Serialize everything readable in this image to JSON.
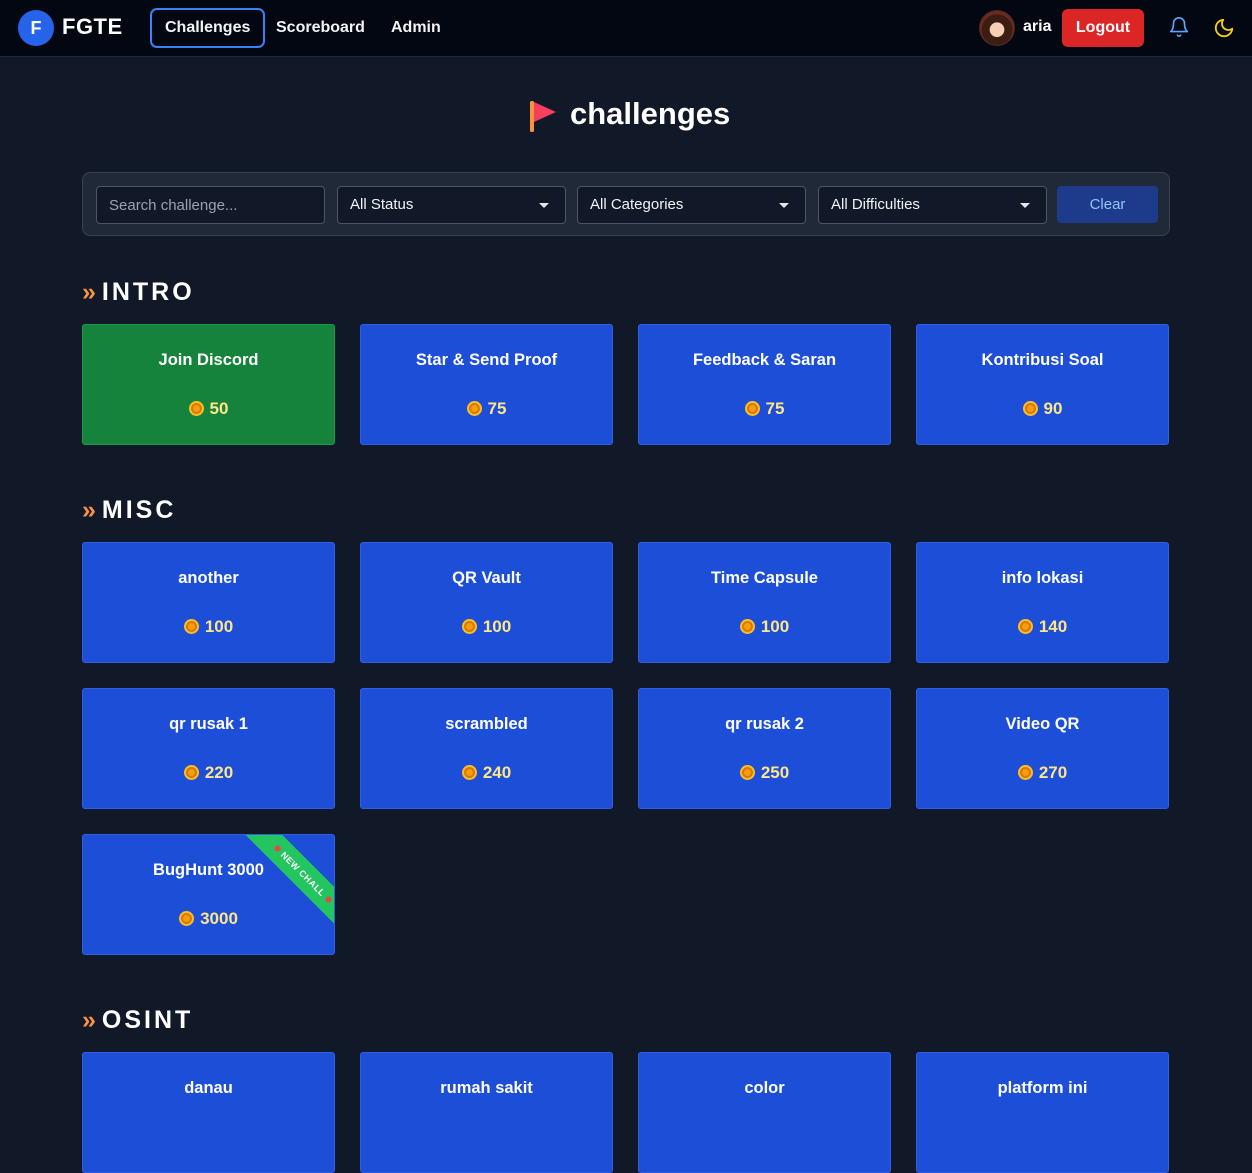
{
  "header": {
    "brand_initial": "F",
    "brand_name": "FGTE",
    "nav": [
      {
        "label": "Challenges",
        "active": true
      },
      {
        "label": "Scoreboard",
        "active": false
      },
      {
        "label": "Admin",
        "active": false
      }
    ],
    "username": "aria",
    "logout_label": "Logout"
  },
  "page": {
    "title": "challenges"
  },
  "filters": {
    "search_placeholder": "Search challenge...",
    "status": "All Status",
    "category": "All Categories",
    "difficulty": "All Difficulties",
    "clear_label": "Clear"
  },
  "sections": [
    {
      "name": "INTRO",
      "challenges": [
        {
          "title": "Join Discord",
          "points": "50",
          "solved": true
        },
        {
          "title": "Star & Send Proof",
          "points": "75",
          "solved": false
        },
        {
          "title": "Feedback & Saran",
          "points": "75",
          "solved": false
        },
        {
          "title": "Kontribusi Soal",
          "points": "90",
          "solved": false
        }
      ]
    },
    {
      "name": "MISC",
      "challenges": [
        {
          "title": "another",
          "points": "100",
          "solved": false
        },
        {
          "title": "QR Vault",
          "points": "100",
          "solved": false
        },
        {
          "title": "Time Capsule",
          "points": "100",
          "solved": false
        },
        {
          "title": "info lokasi",
          "points": "140",
          "solved": false
        },
        {
          "title": "qr rusak 1",
          "points": "220",
          "solved": false
        },
        {
          "title": "scrambled",
          "points": "240",
          "solved": false
        },
        {
          "title": "qr rusak 2",
          "points": "250",
          "solved": false
        },
        {
          "title": "Video QR",
          "points": "270",
          "solved": false
        },
        {
          "title": "BugHunt 3000",
          "points": "3000",
          "solved": false,
          "ribbon": "NEW CHALL"
        }
      ]
    },
    {
      "name": "OSINT",
      "challenges": [
        {
          "title": "danau",
          "points": "",
          "solved": false
        },
        {
          "title": "rumah sakit",
          "points": "",
          "solved": false
        },
        {
          "title": "color",
          "points": "",
          "solved": false
        },
        {
          "title": "platform ini",
          "points": "",
          "solved": false
        }
      ]
    }
  ],
  "colors": {
    "background": "#111827",
    "card_unsolved": "#1d4ed8",
    "card_solved": "#16833c",
    "accent_chevron": "#fb923c",
    "logout": "#dc2626",
    "ribbon": "#22c55e"
  },
  "icons": [
    "bell-icon",
    "moon-icon",
    "flag-icon",
    "coin-icon",
    "caret-down-icon"
  ]
}
